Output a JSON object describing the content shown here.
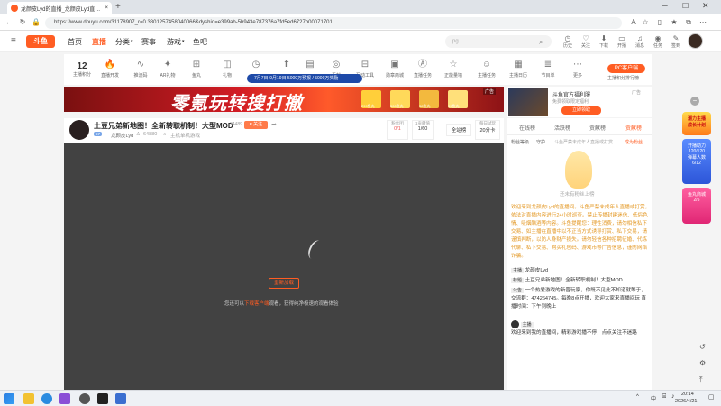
{
  "browser": {
    "tab_title": "龙颜皮Lyd的直播_龙颜皮Lyd直播_龙...",
    "url": "https://www.douyu.com/31178907_r=0.3801257458040066&dyshid=e399ab-5b943e787376a7fd5ed6727b00071701",
    "new_tab": "+",
    "close_tab": "×"
  },
  "header": {
    "logo": "斗鱼",
    "nav": [
      "首页",
      "直播",
      "分类",
      "赛事",
      "游戏",
      "鱼吧"
    ],
    "search_placeholder": "pg",
    "icons": [
      "历史",
      "关注",
      "下载",
      "开播",
      "消息",
      "任务",
      "签到"
    ]
  },
  "toolbar": {
    "level": "12",
    "level_label": "主播积分",
    "items": [
      "直播开发",
      "推流码",
      "AR礼物",
      "鱼丸",
      "礼物",
      "",
      "",
      "",
      "贡献",
      "互动工具",
      "勋章商城",
      "直播任务",
      "正能量墙",
      "主播任务",
      "主播日历",
      "节目单",
      "更多"
    ],
    "item_icons": [
      "fire-icon",
      "wave-icon",
      "ar-icon",
      "gift-icon",
      "bag-icon",
      "clock-icon",
      "rocket-icon",
      "chart-icon",
      "camera-icon",
      "grid-icon",
      "tv-icon",
      "ad-icon",
      "star-icon",
      "person-icon",
      "calendar-icon",
      "stack-icon",
      "more-icon"
    ],
    "promo": "7月7日-9月19日 5000万预报 / 5000万奖励",
    "pc_button": "PC客户端",
    "pc_sub": "主播积分排行榜"
  },
  "banner": {
    "title": "零氪玩转搜打撤",
    "tag": "广告",
    "sub_labels": [
      "299鱼丸",
      "500鱼丸",
      "38鱼丸",
      "99鱼丸"
    ],
    "ad2_title": "斗鱼官方福利服",
    "ad2_line": "免费领取限定福利",
    "ad2_button": "立即领取"
  },
  "streamer": {
    "title": "土豆兄弟新地图！全新转职机制！大型MOD",
    "room_id": "34489",
    "follow": "关注",
    "name": "龙颜皮Lyd",
    "level": "57",
    "followers": "64880",
    "category": "主机单机游戏",
    "stats": [
      {
        "label": "粉丝团",
        "value": "0/1"
      },
      {
        "label": "1贡献值",
        "value": "1/60"
      },
      {
        "label": "全站榜",
        "value": ""
      },
      {
        "label": "每日试玩",
        "value": "20分卡"
      }
    ]
  },
  "player": {
    "retry": "重新加载",
    "tip_prefix": "您还可以",
    "tip_link": "下载客户端",
    "tip_suffix": "观看，获得纯净极速的观看体验"
  },
  "side": {
    "tabs": [
      "在线榜",
      "活跃榜",
      "贡献榜",
      "贡献榜"
    ],
    "fans_label": "粉丝等级",
    "guard_label": "守护",
    "fans_hint": "斗鱼严禁未成年人直播或打赏",
    "become_fans": "成为粉丝",
    "empty_hint": "还未有粉丝上榜",
    "notice": "欢迎来到龙颜皮Lyd的直播间。斗鱼严禁未成年人直播或打赏，依法对直播内容进行24小时巡查。禁止传播封建迷信、低俗色情、吸烟酗酒等内容。斗鱼提醒您：理性消费，请勿相信私下交易、如主播在直播中以不正当方式诱导打赏、私下交易，请谨慎判断，以防人身财产损失。请勿轻信各种招聘征婚、代练代聊、私下交易、购买礼包码、游戏币等广告信息，谨防网络诈骗。",
    "chat": [
      {
        "badge": "主播",
        "text": "龙颜皮Lyd"
      },
      {
        "badge": "标题",
        "text": "土豆兄弟新地图！全新转职机制！大型MOD"
      },
      {
        "badge": "公告",
        "text": "一个热爱游戏的新晋玩家，你既不见此不知道就等于，交流群：474264745。每晚8点开播，欢迎大家来直播间玩 直播时间：下午到晚上"
      }
    ],
    "welcome_name": "主播",
    "welcome": "欢迎来到我的直播间，精彩游戏播不停，点点关注不迷路"
  },
  "rail": {
    "events": [
      "潮力主播\n成长计划",
      "开播助力\n120/120\n弹幕人数\n6/12",
      "鱼丸商城\n2/5"
    ],
    "bottom_icons": [
      "refresh-icon",
      "settings-icon",
      "top-icon"
    ]
  },
  "taskbar": {
    "time": "20:14",
    "date": "2026/4/21",
    "lang": "中"
  },
  "colors": {
    "brand": "#ff5d23",
    "player_bg": "#424242"
  }
}
